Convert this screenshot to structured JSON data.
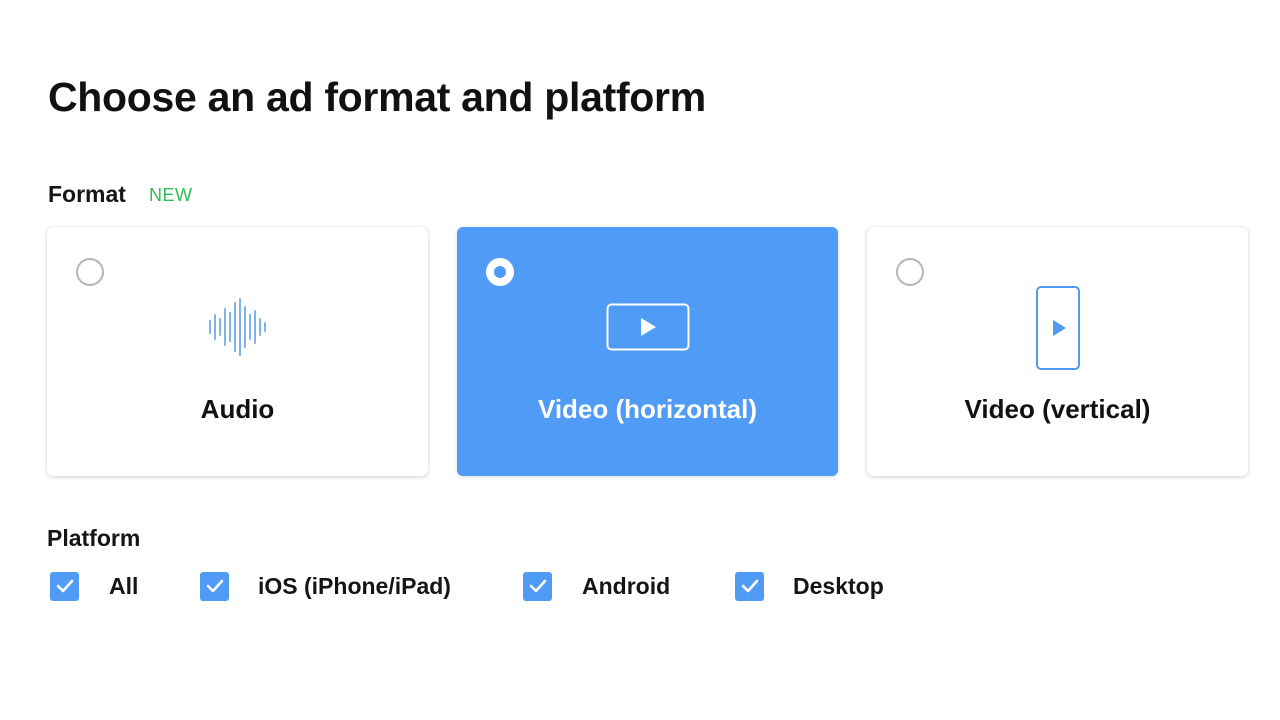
{
  "page": {
    "title": "Choose an ad format and platform"
  },
  "format": {
    "label": "Format",
    "badge": "NEW",
    "accent_color": "#509bf5",
    "badge_color": "#2ebd59",
    "options": [
      {
        "label": "Audio",
        "icon": "audio-waveform-icon",
        "selected": false
      },
      {
        "label": "Video (horizontal)",
        "icon": "horizontal-video-play-icon",
        "selected": true
      },
      {
        "label": "Video (vertical)",
        "icon": "vertical-video-play-icon",
        "selected": false
      }
    ]
  },
  "platform": {
    "label": "Platform",
    "options": [
      {
        "label": "All",
        "checked": true,
        "icon": "checkmark-icon"
      },
      {
        "label": "iOS (iPhone/iPad)",
        "checked": true,
        "icon": "checkmark-icon"
      },
      {
        "label": "Android",
        "checked": true,
        "icon": "checkmark-icon"
      },
      {
        "label": "Desktop",
        "checked": true,
        "icon": "checkmark-icon"
      }
    ]
  }
}
